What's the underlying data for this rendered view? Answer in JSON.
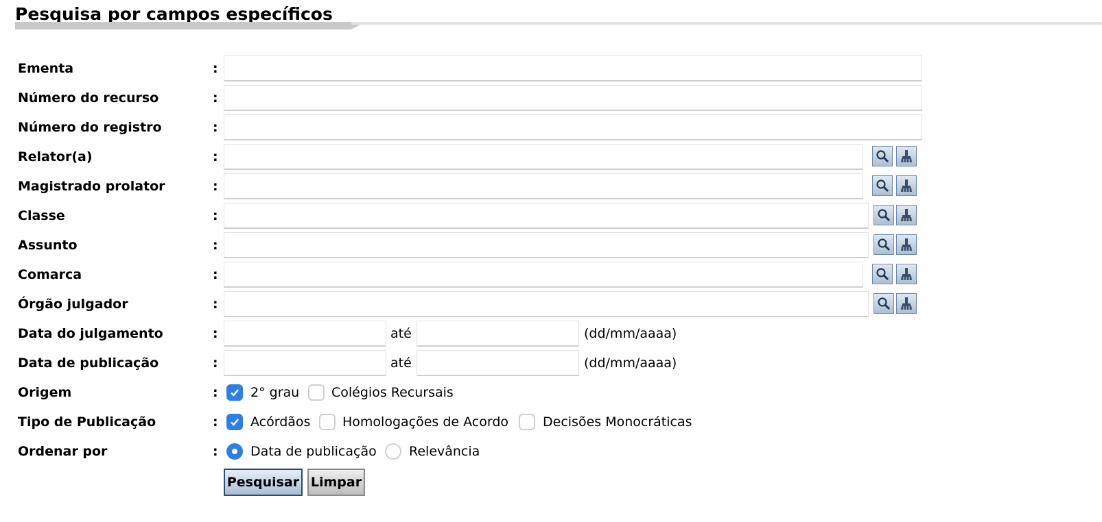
{
  "page": {
    "title": "Pesquisa por campos específicos"
  },
  "fields": {
    "ementa": {
      "label": "Ementa",
      "value": ""
    },
    "numero_recurso": {
      "label": "Número do recurso",
      "value": ""
    },
    "numero_registro": {
      "label": "Número do registro",
      "value": ""
    },
    "relator": {
      "label": "Relator(a)",
      "value": ""
    },
    "magistrado": {
      "label": "Magistrado prolator",
      "value": ""
    },
    "classe": {
      "label": "Classe",
      "value": ""
    },
    "assunto": {
      "label": "Assunto",
      "value": ""
    },
    "comarca": {
      "label": "Comarca",
      "value": ""
    },
    "orgao": {
      "label": "Órgão julgador",
      "value": ""
    },
    "data_julgamento": {
      "label": "Data do julgamento",
      "from": "",
      "to": ""
    },
    "data_publicacao": {
      "label": "Data de publicação",
      "from": "",
      "to": ""
    }
  },
  "separator": ":",
  "range_word": "até",
  "date_hint": "(dd/mm/aaaa)",
  "origem": {
    "label": "Origem",
    "options": [
      {
        "label": "2° grau",
        "checked": true
      },
      {
        "label": "Colégios Recursais",
        "checked": false
      }
    ]
  },
  "tipo_publicacao": {
    "label": "Tipo de Publicação",
    "options": [
      {
        "label": "Acórdãos",
        "checked": true
      },
      {
        "label": "Homologações de Acordo",
        "checked": false
      },
      {
        "label": "Decisões Monocráticas",
        "checked": false
      }
    ]
  },
  "ordenar": {
    "label": "Ordenar por",
    "options": [
      {
        "label": "Data de publicação",
        "selected": true
      },
      {
        "label": "Relevância",
        "selected": false
      }
    ]
  },
  "buttons": {
    "search": "Pesquisar",
    "clear": "Limpar"
  },
  "icons": {
    "lookup": "search-icon",
    "clear_field": "broom-icon"
  },
  "colors": {
    "accent": "#2f7ee6",
    "title_underline": "#c9c9c9",
    "icon_button": "#aebfd3"
  }
}
